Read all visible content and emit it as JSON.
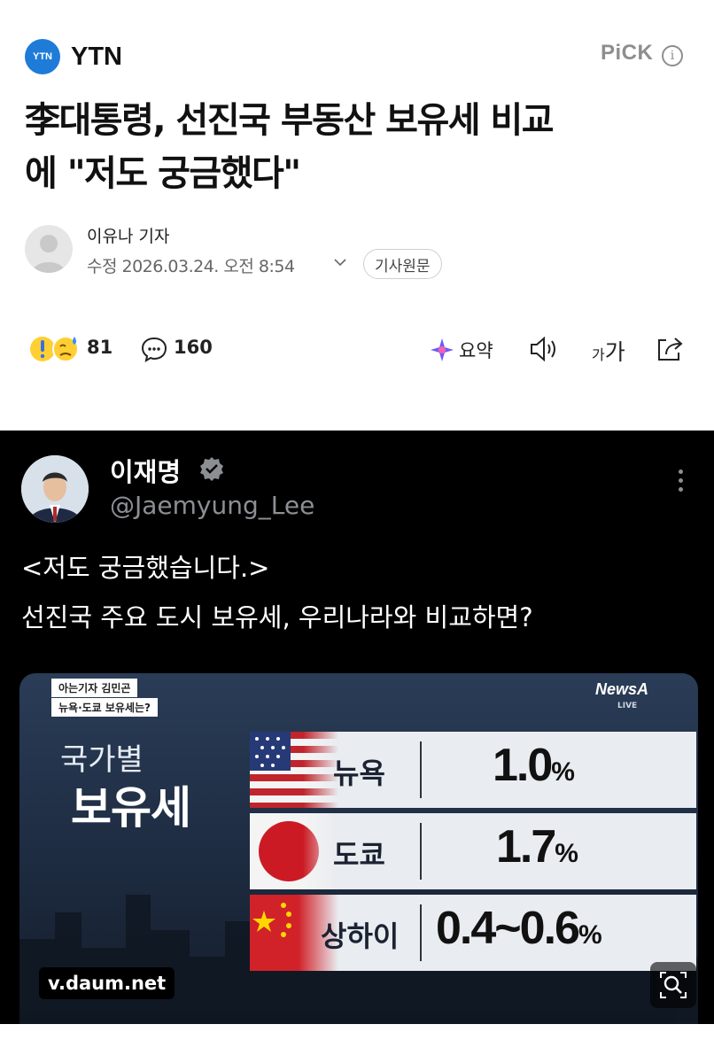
{
  "header": {
    "logo_text": "YTN",
    "press_name": "YTN",
    "pick_label": "PiCK",
    "info_icon": "i"
  },
  "article": {
    "headline_line1": "李대통령, 선진국 부동산 보유세 비교",
    "headline_line2": "에 \"저도 궁금했다\"",
    "reporter": "이유나 기자",
    "date": "수정 2026.03.24. 오전 8:54",
    "original_button": "기사원문"
  },
  "toolbar": {
    "reaction_count": "81",
    "comment_count": "160",
    "summary_label": "요약",
    "font_small": "가",
    "font_large": "가"
  },
  "tweet": {
    "name": "이재명",
    "handle": "@Jaemyung_Lee",
    "line1": "<저도 궁금했습니다.>",
    "line2": "선진국 주요 도시 보유세, 우리나라와 비교하면?"
  },
  "graphic": {
    "tag1": "아는기자   김민곤",
    "tag2": "뉴욕·도쿄 보유세는?",
    "brand": "NewsA",
    "live": "LIVE",
    "title_line1": "국가별",
    "title_line2": "보유세",
    "rows": [
      {
        "city": "뉴욕",
        "rate": "1.0",
        "unit": "%"
      },
      {
        "city": "도쿄",
        "rate": "1.7",
        "unit": "%"
      },
      {
        "city": "상하이",
        "rate": "0.4~0.6",
        "unit": "%"
      }
    ],
    "source": "v.daum.net"
  },
  "colors": {
    "ytn_blue": "#1e7bd8",
    "tweet_bg": "#000000",
    "card_bg": "#1d2b40"
  }
}
